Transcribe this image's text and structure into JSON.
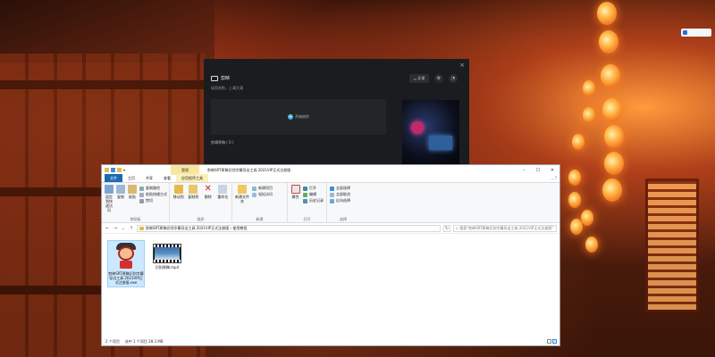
{
  "desktop": {
    "badge": ""
  },
  "dark_app": {
    "brand": "剪映",
    "subtitle": "轻而易剪，上满大满",
    "feedback": "反馈",
    "create": "开始创作",
    "drafts": "剪辑草稿 ( 0 )",
    "close": "×"
  },
  "explorer": {
    "title": "剪映SRT原稿识别字幕导出工具 2021VIP正式注册版",
    "tool_tab": "管理",
    "tabs": {
      "file": "文件",
      "home": "主页",
      "share": "共享",
      "view": "查看",
      "app_tools": "应用程序工具"
    },
    "ribbon": {
      "clipboard": {
        "pin": "固定到快速访问",
        "copy": "复制",
        "paste": "粘贴",
        "copy_path": "复制路径",
        "paste_shortcut": "粘贴快捷方式",
        "cut": "剪切",
        "label": "剪贴板"
      },
      "organize": {
        "move_to": "移动到",
        "copy_to": "复制到",
        "delete": "删除",
        "rename": "重命名",
        "label": "组织"
      },
      "new": {
        "new_folder": "新建文件夹",
        "new_item": "新建项目",
        "easy_access": "轻松访问",
        "label": "新建"
      },
      "open": {
        "properties": "属性",
        "open": "打开",
        "edit": "编辑",
        "history": "历史记录",
        "label": "打开"
      },
      "select": {
        "select_all": "全部选择",
        "select_none": "全部取消",
        "invert": "反向选择",
        "label": "选择"
      }
    },
    "address": {
      "path": "剪映SRT原稿识别字幕导出工具 2021VIP正式注册版 › 使用教程",
      "search_placeholder": "搜索\"剪映SRT原稿识别字幕导出工具 2021VIP正式注册版\""
    },
    "files": [
      {
        "name": "剪映SRT原稿识别字幕导出工具 2021VIP正式注册版.exe",
        "type": "exe",
        "selected": true
      },
      {
        "name": "识别原稿.mp4",
        "type": "mp4",
        "selected": false
      }
    ],
    "status": {
      "count": "2 个项目",
      "selected": "选中 1 个项目  28.3 MB"
    }
  }
}
